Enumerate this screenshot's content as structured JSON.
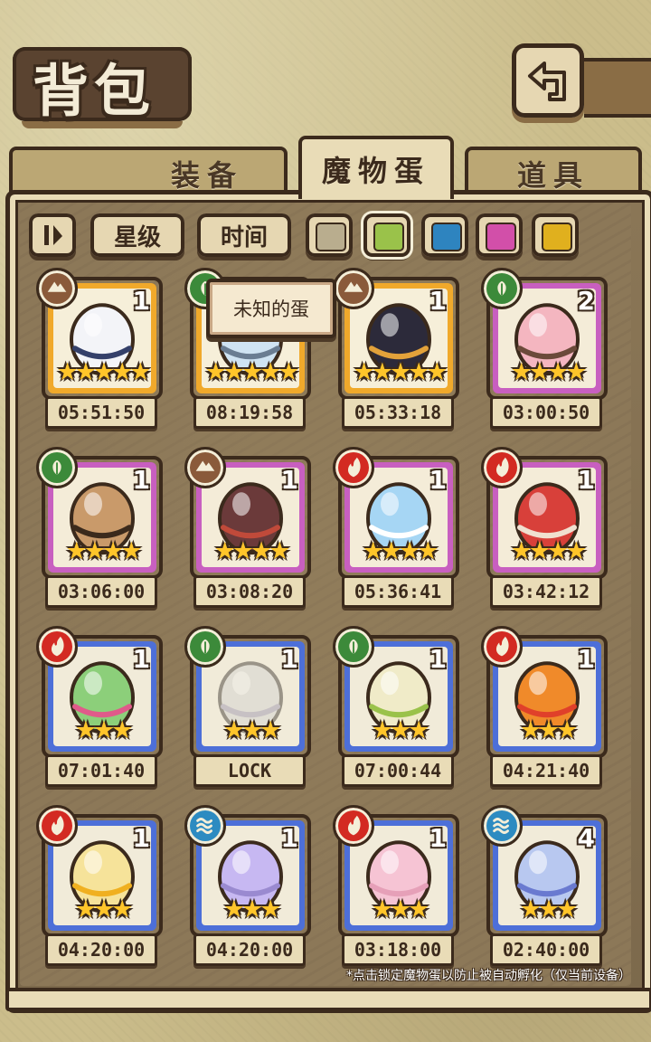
{
  "header": {
    "title": "背包",
    "back_icon": "return-arrow-icon"
  },
  "tabs": [
    {
      "label": "装备",
      "active": false
    },
    {
      "label": "魔物蛋",
      "active": true
    },
    {
      "label": "道具",
      "active": false
    }
  ],
  "filters": {
    "sort_icon": "sort-toggle-icon",
    "star_label": "星级",
    "time_label": "时间",
    "swatches": [
      {
        "name": "gray",
        "color": "#b9ad8e"
      },
      {
        "name": "green",
        "color": "#9ac24a",
        "selected": true
      },
      {
        "name": "blue",
        "color": "#2e84bf"
      },
      {
        "name": "pink",
        "color": "#d24fa9"
      },
      {
        "name": "gold",
        "color": "#e0b01e"
      }
    ]
  },
  "tooltip": "未知的蛋",
  "eggs": [
    {
      "element": "earth",
      "rarity": "gold",
      "stars": "★★★★★",
      "count": "1",
      "timer": "05:51:50",
      "icon": "snow-egg"
    },
    {
      "element": "leaf",
      "rarity": "gold",
      "stars": "★★★★★",
      "count": "",
      "timer": "08:19:58",
      "icon": "clock-egg"
    },
    {
      "element": "earth",
      "rarity": "gold",
      "stars": "★★★★★",
      "count": "1",
      "timer": "05:33:18",
      "icon": "beetle-egg"
    },
    {
      "element": "leaf",
      "rarity": "pink",
      "stars": "★★★★",
      "count": "2",
      "timer": "03:00:50",
      "icon": "pink-egg"
    },
    {
      "element": "leaf",
      "rarity": "pink",
      "stars": "★★★★",
      "count": "1",
      "timer": "03:06:00",
      "icon": "tiger-egg"
    },
    {
      "element": "earth",
      "rarity": "pink",
      "stars": "★★★★",
      "count": "1",
      "timer": "03:08:20",
      "icon": "horn-egg"
    },
    {
      "element": "fire",
      "rarity": "pink",
      "stars": "★★★★",
      "count": "1",
      "timer": "05:36:41",
      "icon": "crystal-egg"
    },
    {
      "element": "fire",
      "rarity": "pink",
      "stars": "★★★★",
      "count": "1",
      "timer": "03:42:12",
      "icon": "red-horn-egg"
    },
    {
      "element": "fire",
      "rarity": "blue",
      "stars": "★★★",
      "count": "1",
      "timer": "07:01:40",
      "icon": "cactus-egg"
    },
    {
      "element": "leaf",
      "rarity": "blue",
      "stars": "★★★",
      "count": "1",
      "timer": "LOCK",
      "icon": "slime-egg",
      "locked": true
    },
    {
      "element": "leaf",
      "rarity": "blue",
      "stars": "★★★",
      "count": "1",
      "timer": "07:00:44",
      "icon": "lotus-egg"
    },
    {
      "element": "fire",
      "rarity": "blue",
      "stars": "★★★",
      "count": "1",
      "timer": "04:21:40",
      "icon": "flame-egg"
    },
    {
      "element": "fire",
      "rarity": "blue",
      "stars": "★★★",
      "count": "1",
      "timer": "04:20:00",
      "icon": "sun-egg"
    },
    {
      "element": "water",
      "rarity": "blue",
      "stars": "★★★",
      "count": "1",
      "timer": "04:20:00",
      "icon": "jelly-egg"
    },
    {
      "element": "fire",
      "rarity": "blue",
      "stars": "★★★",
      "count": "1",
      "timer": "03:18:00",
      "icon": "bubble-egg"
    },
    {
      "element": "water",
      "rarity": "blue",
      "stars": "★★★",
      "count": "4",
      "timer": "02:40:00",
      "icon": "ice-egg"
    }
  ],
  "footnote": "*点击锁定魔物蛋以防止被自动孵化（仅当前设备）"
}
